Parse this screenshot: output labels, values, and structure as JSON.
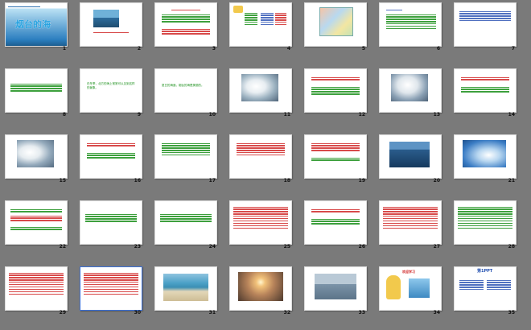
{
  "slides": [
    {
      "number": "1",
      "title": "烟台的海"
    },
    {
      "number": "2"
    },
    {
      "number": "3"
    },
    {
      "number": "4"
    },
    {
      "number": "5"
    },
    {
      "number": "6"
    },
    {
      "number": "7"
    },
    {
      "number": "8"
    },
    {
      "number": "9",
      "text": "在冬季，北方的海上常常可以见到这样的景象。"
    },
    {
      "number": "10",
      "text": "夏日的海面，烟台的海是美丽的。"
    },
    {
      "number": "11"
    },
    {
      "number": "12"
    },
    {
      "number": "13"
    },
    {
      "number": "14"
    },
    {
      "number": "15"
    },
    {
      "number": "16"
    },
    {
      "number": "17"
    },
    {
      "number": "18"
    },
    {
      "number": "19"
    },
    {
      "number": "20"
    },
    {
      "number": "21"
    },
    {
      "number": "22"
    },
    {
      "number": "23"
    },
    {
      "number": "24"
    },
    {
      "number": "25"
    },
    {
      "number": "26"
    },
    {
      "number": "27"
    },
    {
      "number": "28"
    },
    {
      "number": "29"
    },
    {
      "number": "30"
    },
    {
      "number": "31"
    },
    {
      "number": "32"
    },
    {
      "number": "33"
    },
    {
      "number": "34",
      "title": "欢迎学习"
    },
    {
      "number": "35",
      "title": "第1PPT"
    }
  ],
  "colors": {
    "background": "#7a7a7a",
    "slide": "#ffffff",
    "sea": "#2c7fc0",
    "title": "#29a3e0"
  }
}
